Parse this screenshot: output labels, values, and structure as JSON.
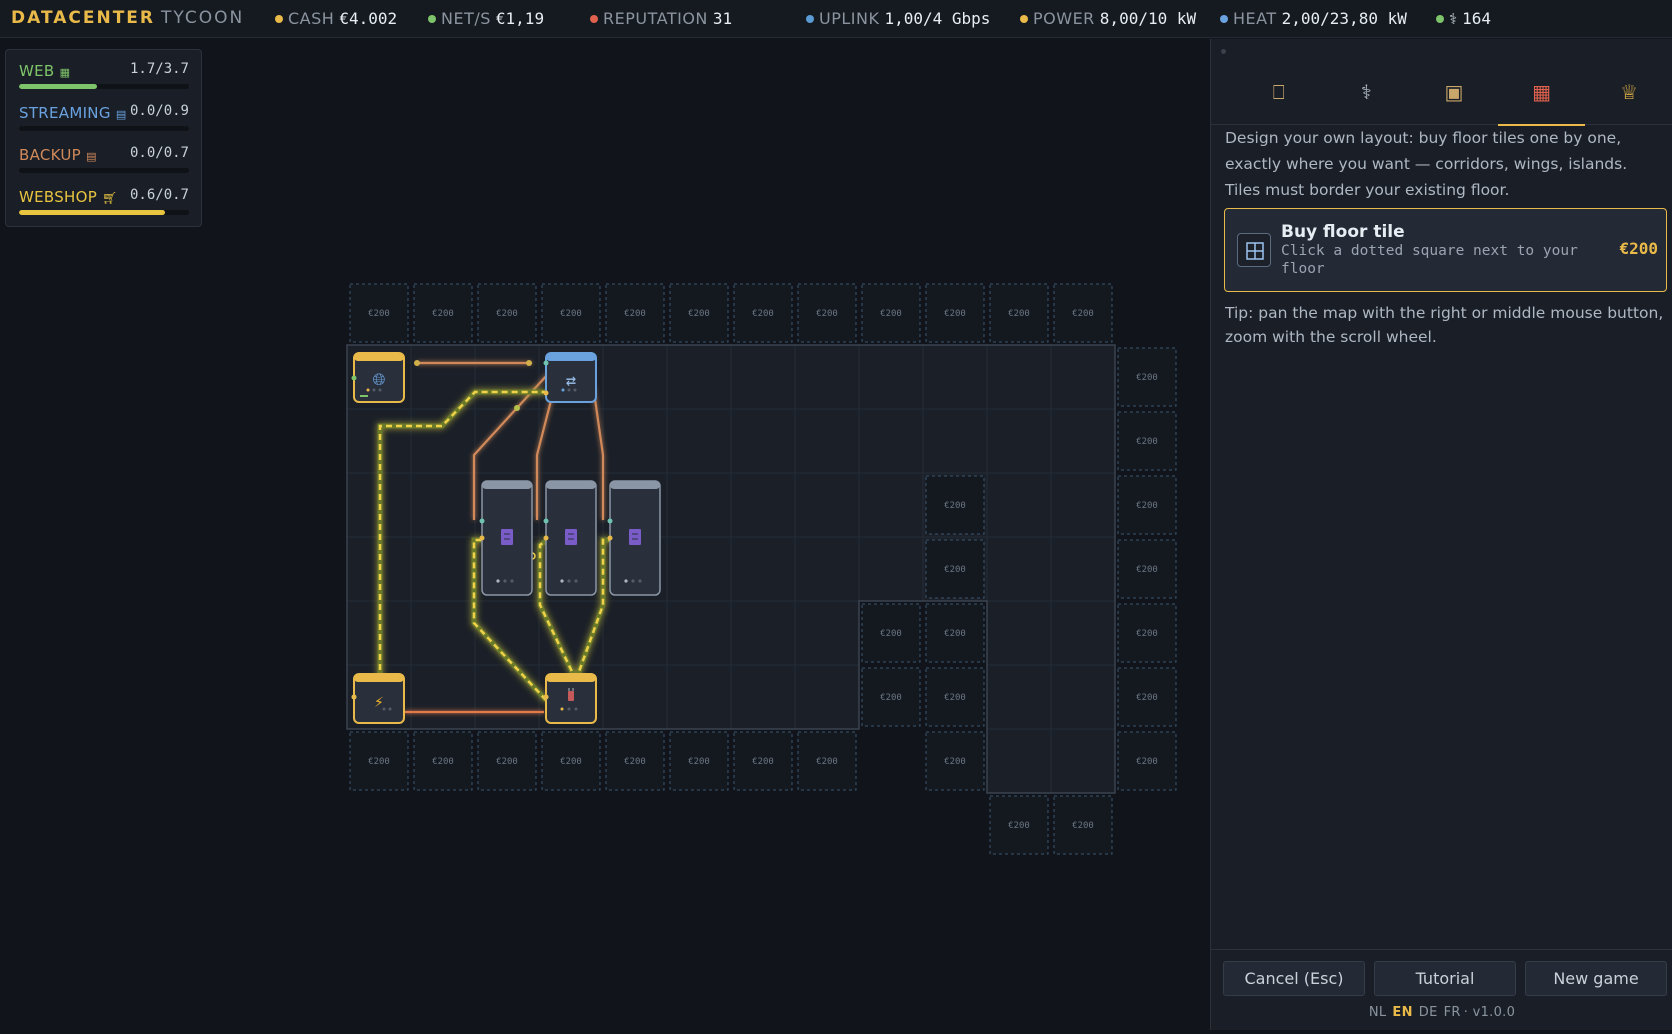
{
  "header": {
    "brand_main": "DATACENTER",
    "brand_sub": "TYCOON",
    "stats": [
      {
        "label": "CASH",
        "value": "€4.002",
        "color": "#e9b949"
      },
      {
        "label": "NET/S",
        "value": "€1,19",
        "color": "#7ec46a"
      },
      {
        "label": "REPUTATION",
        "value": "31",
        "color": "#e0614d"
      },
      {
        "label": "UPLINK",
        "value": "1,00/4 Gbps",
        "color": "#5b9bd5"
      },
      {
        "label": "POWER",
        "value": "8,00/10 kW",
        "color": "#e9b949"
      },
      {
        "label": "HEAT",
        "value": "2,00/23,80 kW",
        "color": "#6aa2e0"
      },
      {
        "label": "",
        "value": "164",
        "color": "#7ec46a",
        "icon": "microscope-icon"
      }
    ]
  },
  "services": [
    {
      "name": "WEB",
      "icon": "grid-icon",
      "capacity": "1.7/3.7",
      "load": 0.46,
      "color": "#7ec46a"
    },
    {
      "name": "STREAMING",
      "icon": "film-icon",
      "capacity": "0.0/0.9",
      "load": 0.0,
      "color": "#6aa2e0"
    },
    {
      "name": "BACKUP",
      "icon": "archive-icon",
      "capacity": "0.0/0.7",
      "load": 0.0,
      "color": "#d1895a"
    },
    {
      "name": "WEBSHOP",
      "icon": "cart-icon",
      "capacity": "0.6/0.7",
      "load": 0.86,
      "color": "#e9c440"
    }
  ],
  "map": {
    "tile_price": "€200",
    "devices": [
      {
        "id": "internet",
        "icon": "globe-icon",
        "type": "internet-gateway"
      },
      {
        "id": "switch",
        "icon": "switch-arrows-icon",
        "type": "network-switch"
      },
      {
        "id": "server-1",
        "icon": "server-icon",
        "type": "server"
      },
      {
        "id": "server-2",
        "icon": "server-icon",
        "type": "server"
      },
      {
        "id": "server-3",
        "icon": "server-icon",
        "type": "server"
      },
      {
        "id": "power",
        "icon": "lightning-icon",
        "type": "power-supply"
      },
      {
        "id": "distribution",
        "icon": "plug-icon",
        "type": "power-distribution"
      }
    ]
  },
  "sidebar": {
    "tabs": [
      {
        "name": "build",
        "icon": "tower-icon",
        "active": false
      },
      {
        "name": "research",
        "icon": "microscope-icon",
        "active": false
      },
      {
        "name": "inventory",
        "icon": "box-icon",
        "active": false
      },
      {
        "name": "floor",
        "icon": "brick-icon",
        "active": true
      },
      {
        "name": "achievements",
        "icon": "trophy-icon",
        "active": false
      }
    ],
    "description": "Design your own layout: buy floor tiles one by one, exactly where you want — corridors, wings, islands. Tiles must border your existing floor.",
    "buy_card": {
      "title": "Buy floor tile",
      "subtitle": "Click a dotted square next to your floor",
      "price": "€200"
    },
    "tip": "Tip: pan the map with the right or middle mouse button, zoom with the scroll wheel.",
    "buttons": {
      "cancel": "Cancel (Esc)",
      "tutorial": "Tutorial",
      "new_game": "New game"
    },
    "languages": [
      "NL",
      "EN",
      "DE",
      "FR"
    ],
    "active_language": "EN",
    "version": "· v1.0.0"
  }
}
